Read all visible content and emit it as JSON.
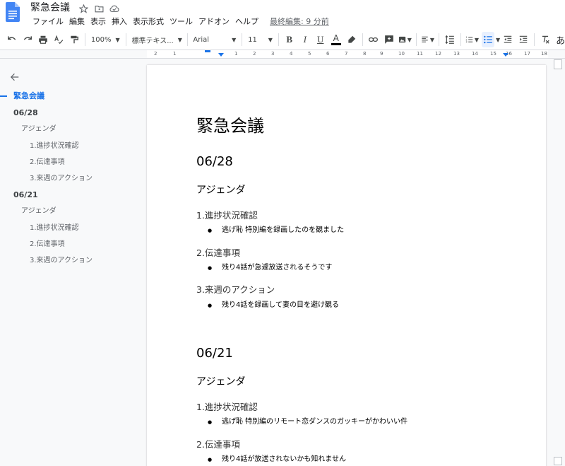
{
  "app": {
    "document_title": "緊急会議",
    "brand_color": "#4285f4",
    "accent_color": "#1a73e8"
  },
  "menubar": {
    "items": [
      "ファイル",
      "編集",
      "表示",
      "挿入",
      "表示形式",
      "ツール",
      "アドオン",
      "ヘルプ"
    ],
    "last_edit": "最終編集: 9 分前"
  },
  "toolbar": {
    "zoom": "100%",
    "style": "標準テキス...",
    "font": "Arial",
    "font_size": "11",
    "bold": "B",
    "italic": "I",
    "underline": "U",
    "text_color": "A",
    "ime_indicator": "あ"
  },
  "ruler": {
    "ticks": [
      "2",
      "1",
      "1",
      "2",
      "3",
      "4",
      "5",
      "6",
      "7",
      "8",
      "9",
      "10",
      "11",
      "12",
      "13",
      "14",
      "15",
      "16",
      "17",
      "18"
    ]
  },
  "outline": {
    "items": [
      {
        "level": 1,
        "text": "緊急会議"
      },
      {
        "level": 2,
        "text": "06/28"
      },
      {
        "level": 3,
        "text": "アジェンダ"
      },
      {
        "level": 4,
        "text": "1.進捗状況確認"
      },
      {
        "level": 4,
        "text": "2.伝達事項"
      },
      {
        "level": 4,
        "text": "3.来週のアクション"
      },
      {
        "level": 2,
        "text": "06/21"
      },
      {
        "level": 3,
        "text": "アジェンダ"
      },
      {
        "level": 4,
        "text": "1.進捗状況確認"
      },
      {
        "level": 4,
        "text": "2.伝達事項"
      },
      {
        "level": 4,
        "text": "3.来週のアクション"
      }
    ]
  },
  "document": {
    "title": "緊急会議",
    "sections": [
      {
        "date": "06/28",
        "agenda": "アジェンダ",
        "items": [
          {
            "heading": "1.進捗状況確認",
            "bullet": "逃げ恥 特別編を録画したのを観ました"
          },
          {
            "heading": "2.伝達事項",
            "bullet": "残り4話が急遽放送されるそうです"
          },
          {
            "heading": "3.来週のアクション",
            "bullet": "残り4話を録画して妻の目を避け観る"
          }
        ]
      },
      {
        "date": "06/21",
        "agenda": "アジェンダ",
        "items": [
          {
            "heading": "1.進捗状況確認",
            "bullet": "逃げ恥 特別編のリモート恋ダンスのガッキーがかわいい件"
          },
          {
            "heading": "2.伝達事項",
            "bullet": "残り4話が放送されないかも知れません"
          }
        ]
      }
    ]
  }
}
